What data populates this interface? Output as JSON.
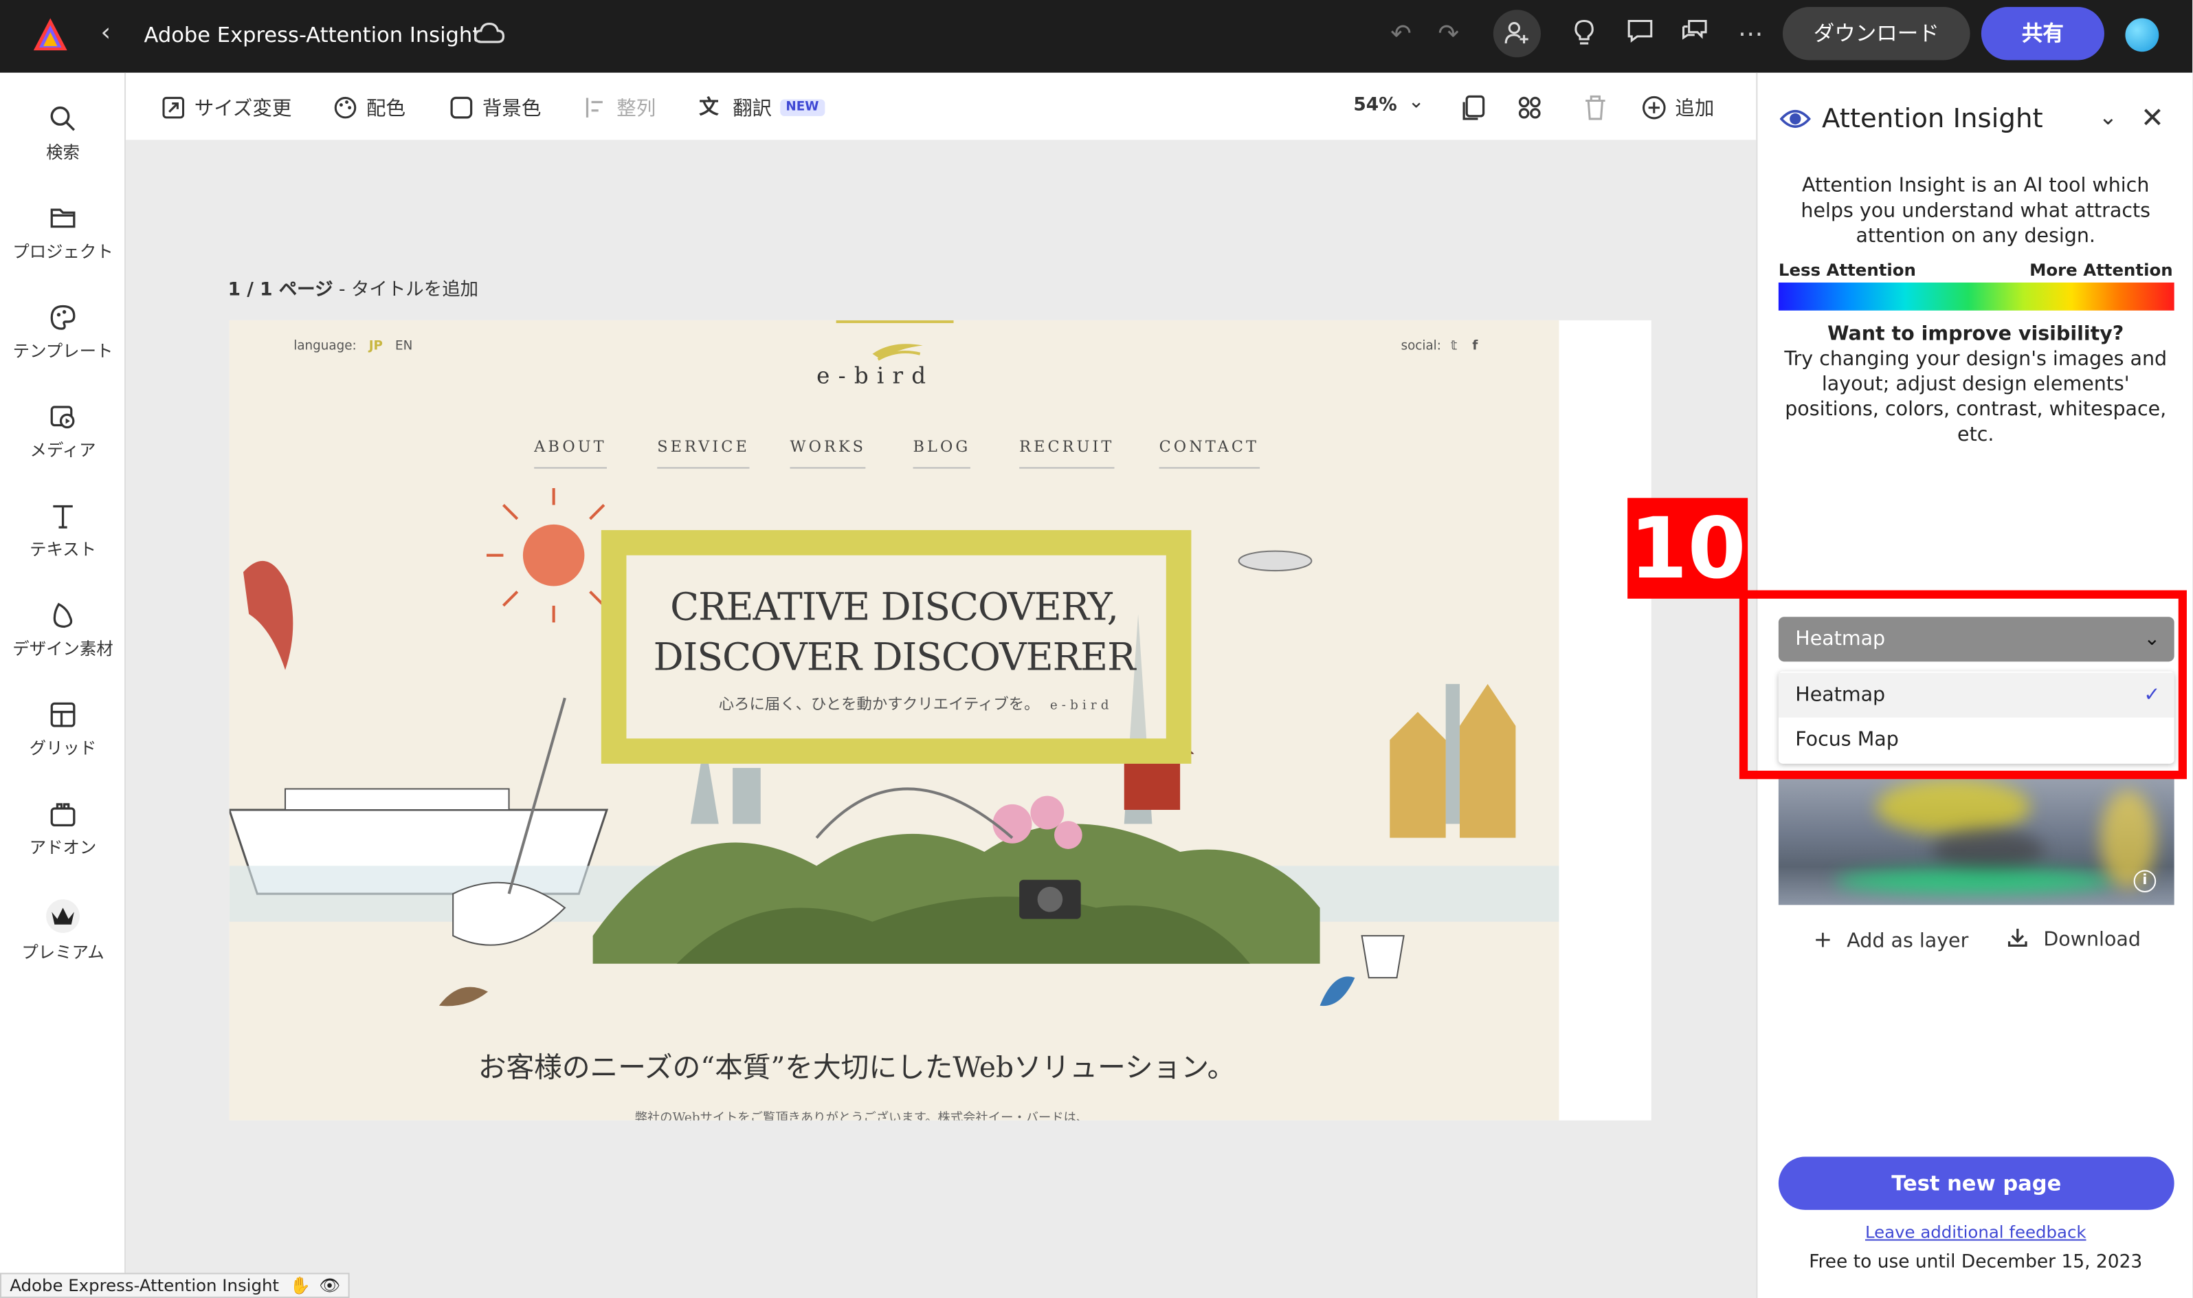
{
  "app": {
    "title": "Adobe Express-Attention Insight",
    "download_label": "ダウンロード",
    "share_label": "共有"
  },
  "sidebar": {
    "items": [
      {
        "label": "検索",
        "icon": "search-icon"
      },
      {
        "label": "プロジェクト",
        "icon": "folder-icon"
      },
      {
        "label": "テンプレート",
        "icon": "template-icon"
      },
      {
        "label": "メディア",
        "icon": "media-icon"
      },
      {
        "label": "テキスト",
        "icon": "text-icon"
      },
      {
        "label": "デザイン素材",
        "icon": "design-elements-icon"
      },
      {
        "label": "グリッド",
        "icon": "grid-icon"
      },
      {
        "label": "アドオン",
        "icon": "addon-icon"
      },
      {
        "label": "プレミアム",
        "icon": "premium-crown-icon"
      }
    ]
  },
  "toolbar": {
    "resize": "サイズ変更",
    "color": "配色",
    "background": "背景色",
    "align": "整列",
    "translate": "翻訳",
    "new_badge": "NEW",
    "zoom": "54%",
    "add": "追加"
  },
  "canvas": {
    "page_counter": "1 / 1 ページ",
    "page_title": "タイトルを追加"
  },
  "design": {
    "language_label": "language:",
    "lang_jp": "JP",
    "lang_en": "EN",
    "social_label": "social:",
    "brand": "e-bird",
    "nav": [
      "ABOUT",
      "SERVICE",
      "WORKS",
      "BLOG",
      "RECRUIT",
      "CONTACT"
    ],
    "hero_line1": "CREATIVE DISCOVERY,",
    "hero_line2": "DISCOVER DISCOVERER",
    "hero_sub": "心ろに届く、ひとを動かすクリエイティブを。",
    "hero_sub_brand": "e-bird",
    "tagline": "お客様のニーズの“本質”を大切にしたWebソリューション。",
    "small_text": "弊社のWebサイトをご覧頂きありがとうございます。株式会社イー・バードは、"
  },
  "panel": {
    "title": "Attention Insight",
    "description": "Attention Insight is an AI tool which helps you understand what attracts attention on any design.",
    "less_attention": "Less Attention",
    "more_attention": "More Attention",
    "question": "Want to improve visibility?",
    "tip": "Try changing your design's images and layout; adjust design elements' positions, colors, contrast, whitespace, etc.",
    "dropdown": {
      "selected": "Heatmap",
      "options": [
        "Heatmap",
        "Focus Map"
      ]
    },
    "add_layer": "Add as layer",
    "download": "Download",
    "test_button": "Test new page",
    "feedback": "Leave additional feedback",
    "free_until": "Free to use until December 15, 2023"
  },
  "annotation": {
    "number": "10",
    "color": "#ff0000"
  },
  "status_bar": {
    "text": "Adobe Express-Attention Insight"
  },
  "colors": {
    "accent": "#5258e4",
    "topbar": "#1d1d1d"
  }
}
